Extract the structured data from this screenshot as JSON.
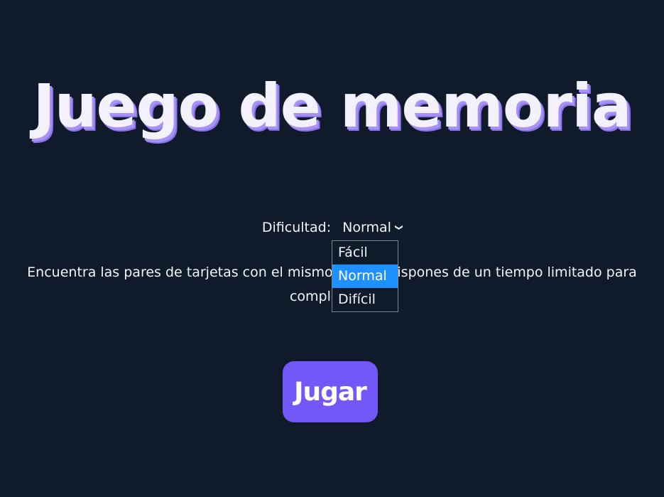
{
  "game": {
    "title": "Juego de memoria",
    "difficulty": {
      "label": "Dificultad:",
      "selected": "Normal",
      "options": [
        "Fácil",
        "Normal",
        "Difícil"
      ]
    },
    "description_line1": "Encuentra las pares de tarjetas con el mismo dibujo. Dispones de un tiempo limitado para",
    "description_line2": "completarlo.",
    "play_button": "Jugar"
  }
}
